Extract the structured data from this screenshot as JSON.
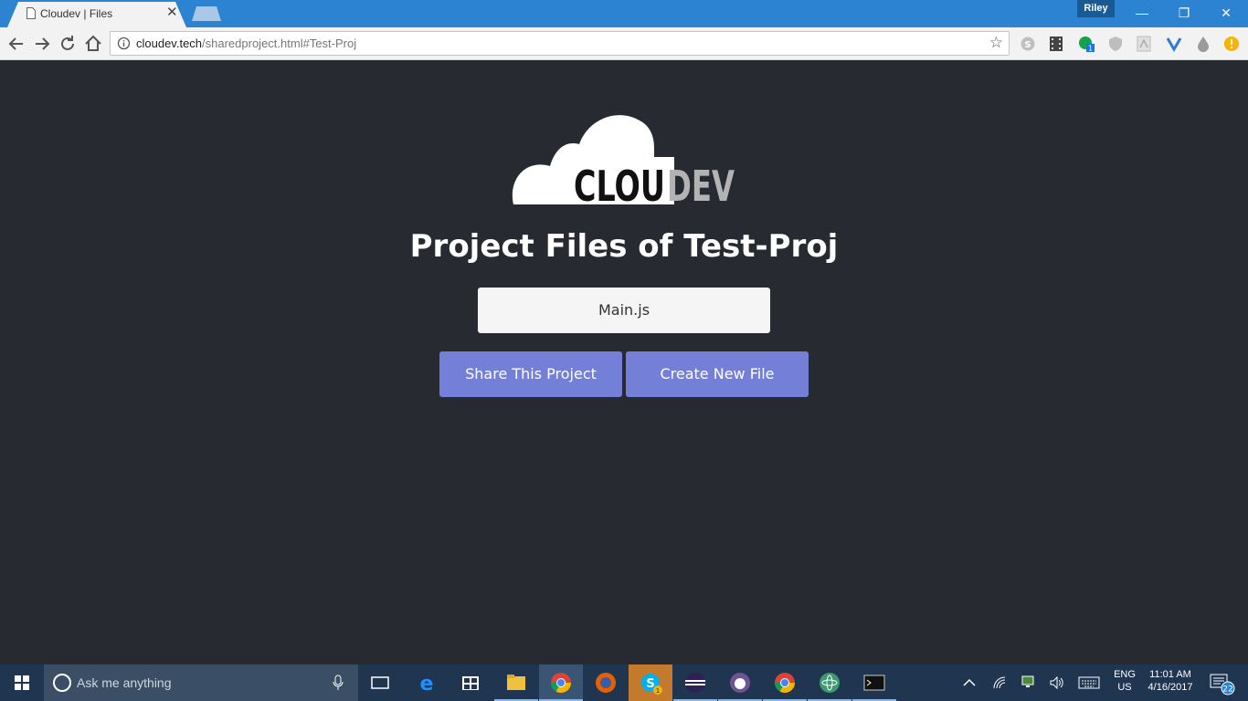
{
  "browser": {
    "tab_title": "Cloudev | Files",
    "tab_close": "✕",
    "profile_name": "Riley",
    "window_controls": {
      "minimize": "—",
      "restore": "❐",
      "close": "✕"
    },
    "url_host": "cloudev.tech",
    "url_path": "/sharedproject.html#Test-Proj",
    "bookmark_star": "☆",
    "extensions": [
      "skype-icon",
      "film-icon",
      "grammarly-icon",
      "shield-icon",
      "pdf-icon",
      "vimium-icon",
      "drop-icon",
      "warning-icon"
    ],
    "extension_badge": "1"
  },
  "page": {
    "logo_dark": "CLOU",
    "logo_light": "DEV",
    "title": "Project Files of Test-Proj",
    "files": [
      "Main.js"
    ],
    "share_button": "Share This Project",
    "create_button": "Create New File",
    "background": "#272a31",
    "accent": "#7480d7"
  },
  "taskbar": {
    "search_placeholder": "Ask me anything",
    "apps": [
      "task-view-icon",
      "edge-icon",
      "store-icon",
      "file-explorer-icon",
      "chrome-icon",
      "firefox-icon",
      "skype-icon",
      "eclipse-icon",
      "github-icon",
      "chrome-icon",
      "atom-icon",
      "terminal-icon"
    ],
    "skype_badge": "1",
    "language_1": "ENG",
    "language_2": "US",
    "time": "11:01 AM",
    "date": "4/16/2017",
    "notification_count": "22"
  }
}
